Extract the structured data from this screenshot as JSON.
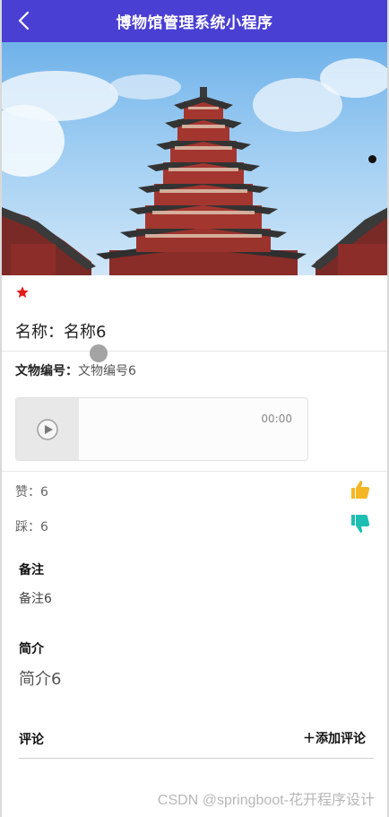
{
  "header": {
    "title": "博物馆管理系统小程序"
  },
  "detail": {
    "name_prefix": "名称：",
    "name_value": "名称6",
    "code_label": "文物编号：",
    "code_value": "文物编号6",
    "audio_time": "00:00",
    "like_label": "赞：",
    "like_count": "6",
    "dislike_label": "踩：",
    "dislike_count": "6",
    "remark_label": "备注",
    "remark_value": "备注6",
    "intro_label": "简介",
    "intro_value": "简介6",
    "comment_label": "评论",
    "add_comment": "＋添加评论"
  },
  "watermark": "CSDN @springboot-花开程序设计",
  "icons": {
    "back": "chevron-left-icon",
    "favorite": "star-icon",
    "play": "play-icon",
    "like": "thumbs-up-icon",
    "dislike": "thumbs-down-icon"
  },
  "colors": {
    "header": "#4a3fd3",
    "star": "#e31b1b",
    "like": "#f5b623",
    "dislike": "#1dbfb2"
  }
}
